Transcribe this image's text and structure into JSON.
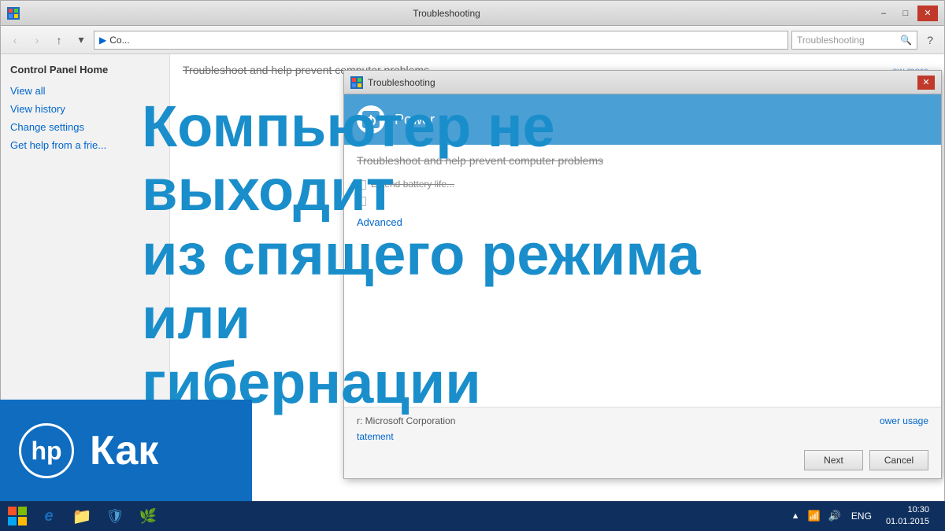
{
  "window": {
    "title": "Troubleshooting",
    "controls": {
      "minimize": "–",
      "maximize": "□",
      "close": "✕"
    }
  },
  "browser": {
    "nav": {
      "back": "‹",
      "forward": "›",
      "up": "↑",
      "recent": "▾"
    },
    "address": "Co...",
    "search_placeholder": "Troubleshooting",
    "help": "?"
  },
  "sidebar": {
    "title": "Control Panel Home",
    "links": [
      "View all",
      "View history",
      "Change settings",
      "Get help from a frie..."
    ]
  },
  "main_content": {
    "heading": "Troubleshoot and help prevent computer problems"
  },
  "dialog": {
    "title": "Troubleshooting",
    "close": "✕",
    "header": {
      "icon": "⚡",
      "title": "Power"
    },
    "subtitle": "Troubleshoot and help prevent computer problems",
    "rows": [
      "Extend battery life...",
      ""
    ],
    "advanced_link": "Advanced",
    "footer": {
      "publisher_label": "r: Microsoft Corporation",
      "privacy_link": "tatement",
      "power_link": "ower usage",
      "next_btn": "Next",
      "cancel_btn": "Cancel"
    }
  },
  "russian_text": {
    "line1": "Компьютер не выходит",
    "line2": "из спящего режима или",
    "line3": "гибернации"
  },
  "hp_branding": {
    "logo": "hp",
    "label": "Как"
  },
  "taskbar": {
    "apps": [
      {
        "icon": "⊞",
        "name": "windows-start"
      },
      {
        "icon": "e",
        "name": "internet-explorer"
      },
      {
        "icon": "📁",
        "name": "file-explorer"
      },
      {
        "icon": "🛡",
        "name": "windows-security"
      }
    ],
    "tray": {
      "network": "▲",
      "volume": "🔊",
      "lang": "ENG"
    },
    "time": "10:30",
    "date": "01.01.2015"
  },
  "cursor": {
    "position": "next_button_area"
  }
}
